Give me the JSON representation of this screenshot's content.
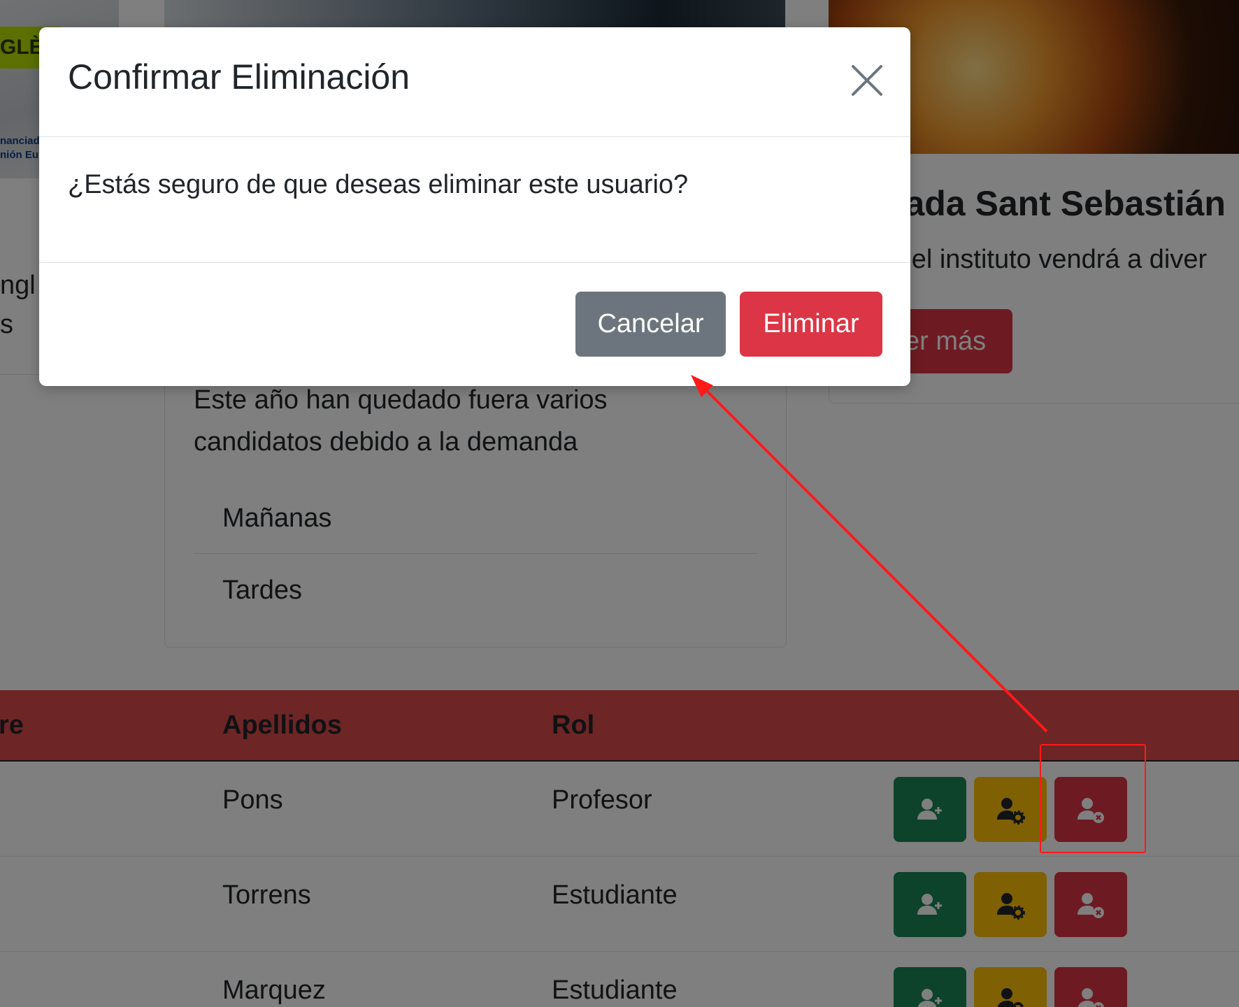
{
  "background": {
    "left_card": {
      "badge_text": "GLÈS",
      "caption_line1": "nanciad",
      "caption_line2": "nión Eu",
      "partial_text_line1": "ngl",
      "partial_text_line2": "s"
    },
    "middle_card": {
      "description_line1": "Este año han quedado fuera varios",
      "description_line2": "candidatos debido a la demanda",
      "list_items": [
        "Mañanas",
        "Tardes"
      ]
    },
    "right_card": {
      "title": "rada Sant Sebastián",
      "text": "o el instituto vendrá a diver",
      "button_label": "er más"
    },
    "table": {
      "headers": {
        "nombre": "re",
        "apellidos": "Apellidos",
        "rol": "Rol"
      },
      "rows": [
        {
          "apellidos": "Pons",
          "rol": "Profesor"
        },
        {
          "apellidos": "Torrens",
          "rol": "Estudiante"
        },
        {
          "apellidos": "Marquez",
          "rol": "Estudiante"
        }
      ],
      "action_icons": [
        "user-plus-icon",
        "user-gear-icon",
        "user-remove-icon"
      ]
    }
  },
  "modal": {
    "title": "Confirmar Eliminación",
    "body": "¿Estás seguro de que deseas eliminar este usuario?",
    "cancel_label": "Cancelar",
    "delete_label": "Eliminar"
  },
  "colors": {
    "danger": "#dc3545",
    "secondary": "#6c757d",
    "success": "#198754",
    "warning": "#ffc107",
    "annotation": "#ff1a1a"
  }
}
